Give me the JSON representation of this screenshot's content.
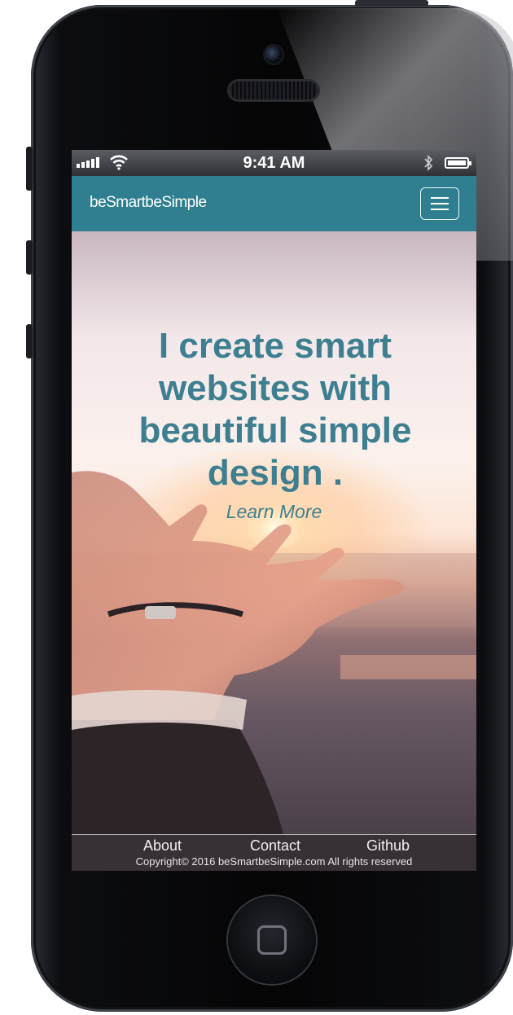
{
  "statusbar": {
    "time": "9:41 AM"
  },
  "navbar": {
    "logo": "beSmartbeSimple"
  },
  "hero": {
    "headline": "I create smart websites with beautiful simple design .",
    "cta": "Learn More"
  },
  "footer": {
    "links": [
      "About",
      "Contact",
      "Github"
    ],
    "copyright": "Copyright© 2016 beSmartbeSimple.com All rights reserved"
  },
  "colors": {
    "brand": "#2f7f90",
    "headline": "#3d7f90"
  },
  "icons": [
    "signal-icon",
    "wifi-icon",
    "bluetooth-icon",
    "battery-icon",
    "hamburger-menu-icon"
  ]
}
